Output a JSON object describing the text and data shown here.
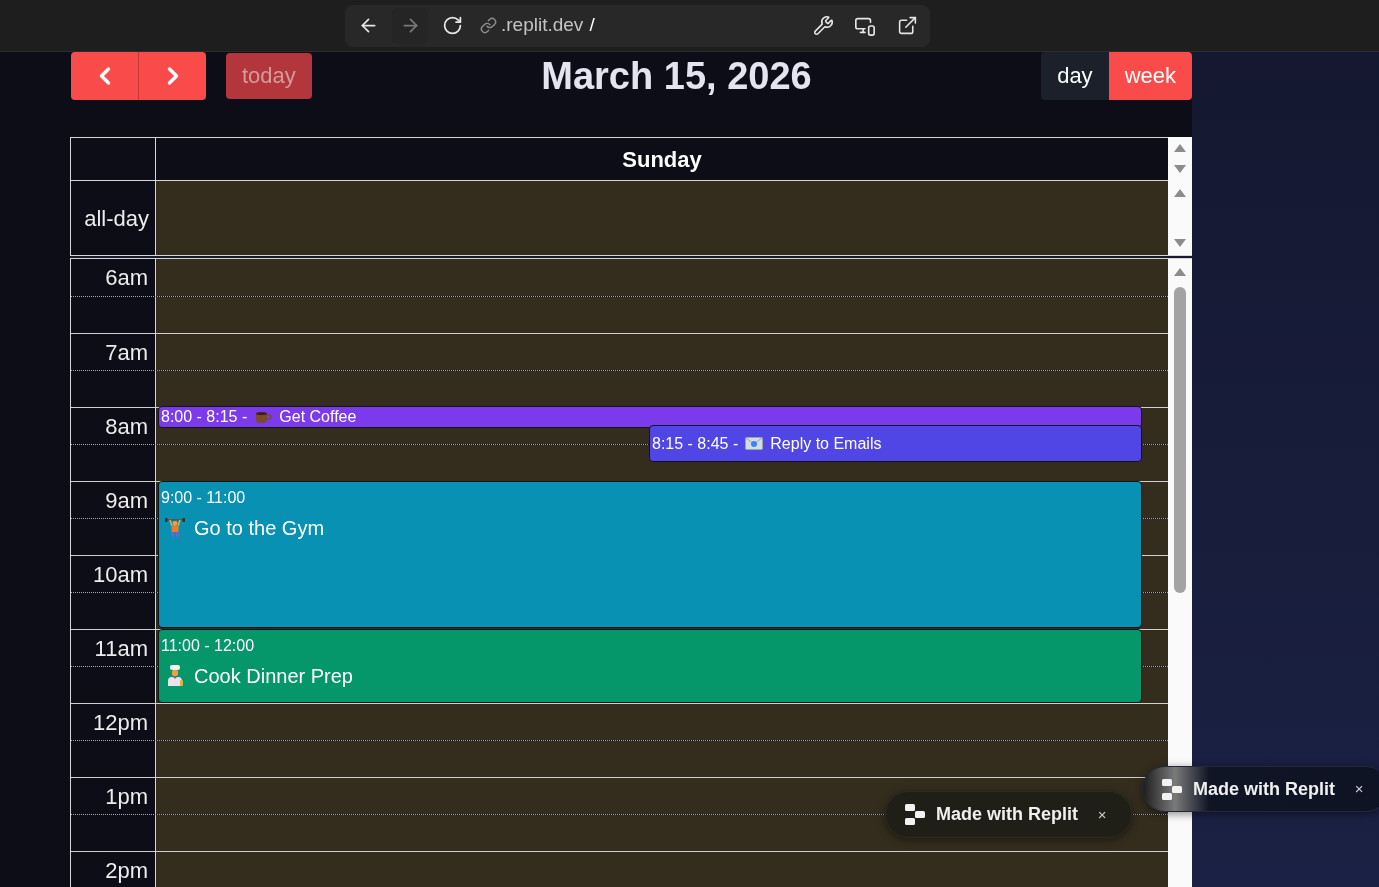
{
  "browser": {
    "nav_buttons": [
      {
        "kind": "back",
        "disabled": false
      },
      {
        "kind": "forward",
        "disabled": true
      },
      {
        "kind": "reload",
        "disabled": false
      }
    ],
    "url_host": ".replit.dev",
    "url_path": "/"
  },
  "toolbar": {
    "today": {
      "label": "today",
      "disabled": true
    },
    "title": "March 15, 2026",
    "views": [
      {
        "label": "day",
        "selected": true
      },
      {
        "label": "week",
        "selected": false
      }
    ]
  },
  "calendar": {
    "day_header": "Sunday",
    "all_day_label": "all-day",
    "hours": [
      "6am",
      "7am",
      "8am",
      "9am",
      "10am",
      "11am",
      "12pm",
      "1pm",
      "2pm"
    ],
    "events": [
      {
        "kind": "compact",
        "time": "8:00 - 8:15 -",
        "title": "Get Coffee",
        "color": "#7c3aed"
      },
      {
        "kind": "compact",
        "time": "8:15 - 8:45 -",
        "title": "Reply to Emails",
        "color": "#4f46e5"
      },
      {
        "kind": "block",
        "time": "9:00 - 11:00",
        "title": "Go to the Gym",
        "color": "#0891b2"
      },
      {
        "kind": "block",
        "time": "11:00 - 12:00",
        "title": "Cook Dinner Prep",
        "color": "#059669"
      }
    ]
  },
  "badges": [
    {
      "label": "Made with Replit",
      "close": "×"
    },
    {
      "label": "Made with Replit",
      "close": "×"
    }
  ]
}
